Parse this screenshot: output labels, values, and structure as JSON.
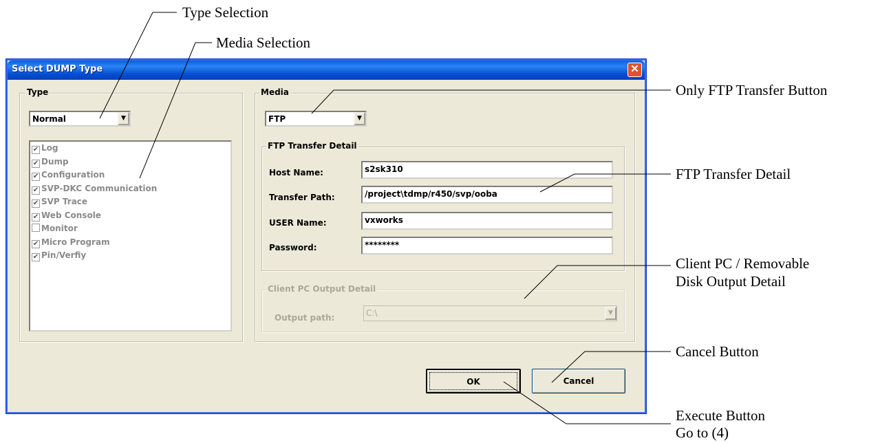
{
  "annotations": {
    "type_selection": "Type Selection",
    "media_selection": "Media Selection",
    "only_ftp": "Only FTP Transfer Button",
    "ftp_detail": "FTP Transfer Detail",
    "client_pc_1": "Client PC / Removable",
    "client_pc_2": "Disk Output Detail",
    "cancel_button": "Cancel Button",
    "execute_1": "Execute Button",
    "execute_2": "Go to (4)"
  },
  "dialog": {
    "title": "Select DUMP Type",
    "close_glyph": "✕"
  },
  "type_group": {
    "legend": "Type",
    "selected": "Normal",
    "items": [
      {
        "label": "Log",
        "checked": true
      },
      {
        "label": "Dump",
        "checked": true
      },
      {
        "label": "Configuration",
        "checked": true
      },
      {
        "label": "SVP-DKC Communication",
        "checked": true
      },
      {
        "label": "SVP Trace",
        "checked": true
      },
      {
        "label": "Web Console",
        "checked": true
      },
      {
        "label": "Monitor",
        "checked": false
      },
      {
        "label": "Micro Program",
        "checked": true
      },
      {
        "label": "Pin/Verfiy",
        "checked": true
      }
    ]
  },
  "media_group": {
    "legend": "Media",
    "selected": "FTP"
  },
  "ftp_group": {
    "legend": "FTP Transfer Detail",
    "host_label": "Host Name:",
    "host_value": "s2sk310",
    "path_label": "Transfer Path:",
    "path_value": "/project\\tdmp/r450/svp/ooba",
    "user_label": "USER Name:",
    "user_value": "vxworks",
    "password_label": "Password:",
    "password_value": "********"
  },
  "client_group": {
    "legend": "Client PC Output Detail",
    "output_label": "Output path:",
    "output_value": "C:\\"
  },
  "buttons": {
    "ok": "OK",
    "cancel": "Cancel"
  },
  "icons": {
    "dropdown": "▼",
    "check": "✔"
  }
}
